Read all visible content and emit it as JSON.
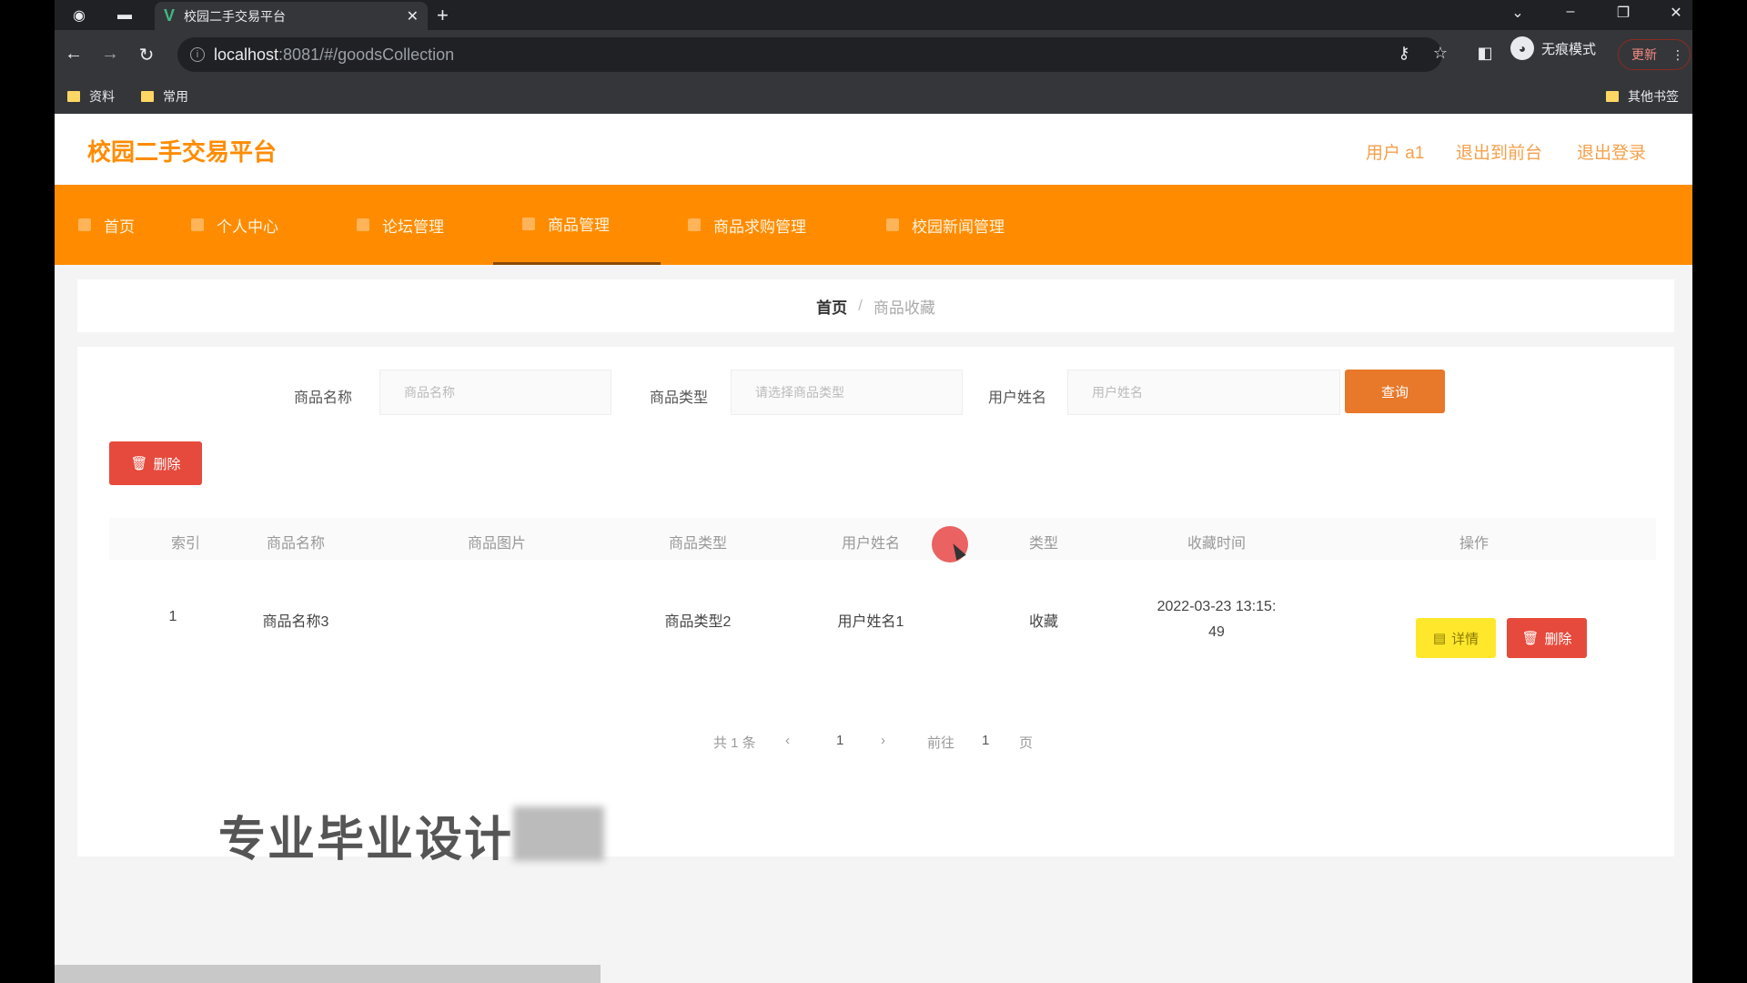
{
  "browser": {
    "tab_title": "校园二手交易平台",
    "url_host": "localhost",
    "url_rest": ":8081/#/goodsCollection",
    "incognito_label": "无痕模式",
    "update_label": "更新",
    "bookmarks": [
      "资料",
      "常用"
    ],
    "other_bookmarks": "其他书签"
  },
  "header": {
    "logo": "校园二手交易平台",
    "user": "用户 a1",
    "back_to_front": "退出到前台",
    "logout": "退出登录"
  },
  "menu": {
    "items": [
      "首页",
      "个人中心",
      "论坛管理",
      "商品管理",
      "商品求购管理",
      "校园新闻管理"
    ],
    "active": "商品管理"
  },
  "breadcrumb": {
    "home": "首页",
    "separator": "/",
    "current": "商品收藏"
  },
  "search": {
    "name_label": "商品名称",
    "name_placeholder": "商品名称",
    "type_label": "商品类型",
    "type_placeholder": "请选择商品类型",
    "user_label": "用户姓名",
    "user_placeholder": "用户姓名",
    "query_button": "查询"
  },
  "actions": {
    "delete": "删除"
  },
  "table": {
    "headers": [
      "索引",
      "商品名称",
      "商品图片",
      "商品类型",
      "用户姓名",
      "类型",
      "收藏时间",
      "操作"
    ],
    "rows": [
      {
        "index": "1",
        "name": "商品名称3",
        "type": "商品类型2",
        "user": "用户姓名1",
        "collect_type": "收藏",
        "time_line1": "2022-03-23 13:15:",
        "time_line2": "49",
        "detail": "详情",
        "delete": "删除"
      }
    ]
  },
  "pager": {
    "total": "共 1 条",
    "page": "1",
    "goto": "前往",
    "goto_page": "1",
    "unit": "页"
  },
  "watermark": "专业毕业设计"
}
